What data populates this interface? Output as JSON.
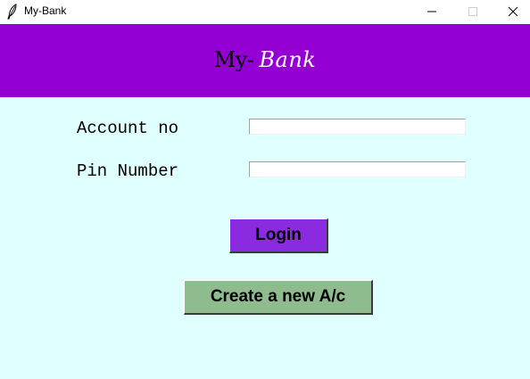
{
  "window": {
    "title": "My-Bank",
    "icon": "feather-icon",
    "controls": [
      "minimize-icon",
      "maximize-icon",
      "close-icon"
    ]
  },
  "header": {
    "title_part1": "My-",
    "title_part2": "Bank",
    "background": "#9400d3"
  },
  "form": {
    "account_label": "Account no",
    "account_value": "",
    "pin_label": "Pin Number",
    "pin_value": ""
  },
  "buttons": {
    "login_label": "Login",
    "login_color": "#8a2be2",
    "create_label": "Create a new A/c",
    "create_color": "#8fbc8f"
  },
  "colors": {
    "body_background": "#e0ffff"
  }
}
